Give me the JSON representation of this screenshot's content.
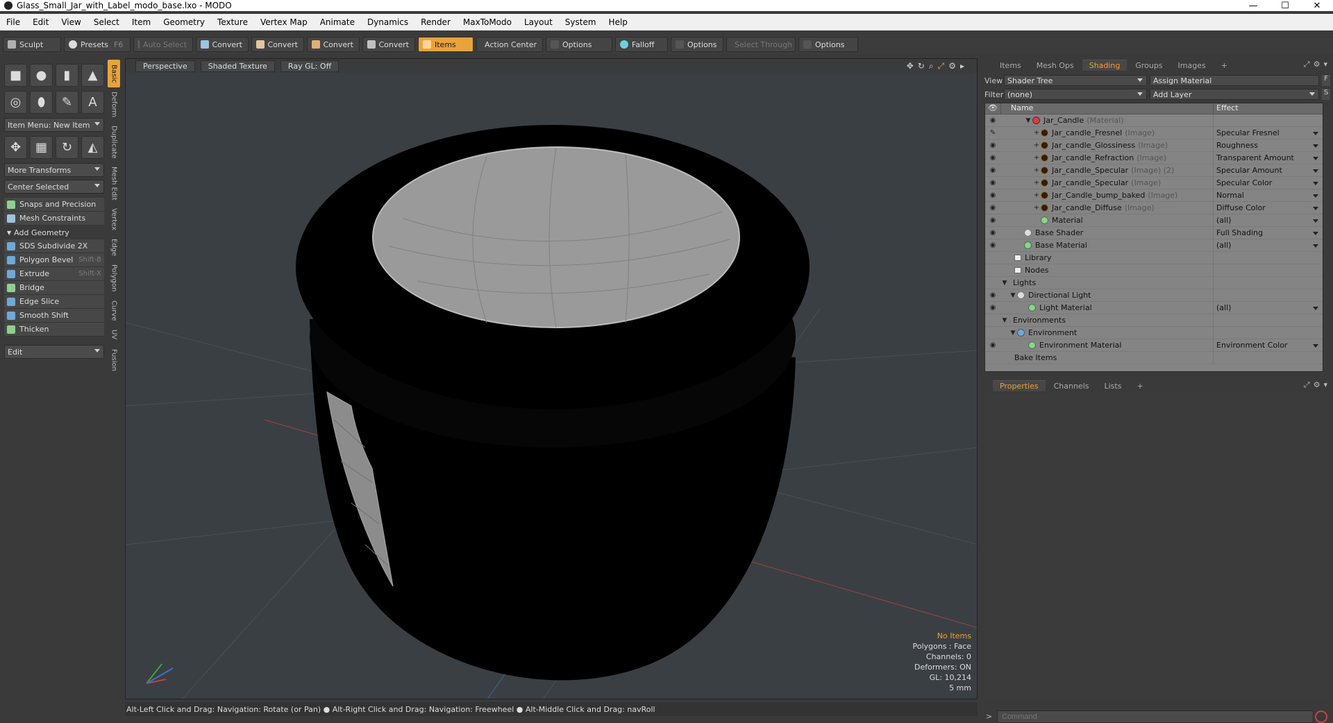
{
  "window": {
    "title": "Glass_Small_Jar_with_Label_modo_base.lxo - MODO",
    "minimize": "—",
    "maximize": "☐",
    "close": "✕"
  },
  "menubar": [
    "File",
    "Edit",
    "View",
    "Select",
    "Item",
    "Geometry",
    "Texture",
    "Vertex Map",
    "Animate",
    "Dynamics",
    "Render",
    "MaxToModo",
    "Layout",
    "System",
    "Help"
  ],
  "toolbar": {
    "sculpt": "Sculpt",
    "presets": "Presets",
    "presets_shortcut": "F6",
    "auto_select": "Auto Select",
    "convert1": "Convert",
    "convert2": "Convert",
    "convert3": "Convert",
    "convert4": "Convert",
    "items": "Items",
    "action_center": "Action Center",
    "options1": "Options",
    "falloff": "Falloff",
    "options2": "Options",
    "select_through": "Select Through",
    "options3": "Options"
  },
  "toolbox": {
    "item_menu": "Item Menu: New Item",
    "more_transforms": "More Transforms",
    "center_selected": "Center Selected",
    "snaps": "Snaps and Precision",
    "mesh_constraints": "Mesh Constraints",
    "add_geometry": "Add Geometry",
    "tools": [
      {
        "label": "SDS Subdivide 2X",
        "shortcut": ""
      },
      {
        "label": "Polygon Bevel",
        "shortcut": "Shift-B"
      },
      {
        "label": "Extrude",
        "shortcut": "Shift-X"
      },
      {
        "label": "Bridge",
        "shortcut": ""
      },
      {
        "label": "Edge Slice",
        "shortcut": ""
      },
      {
        "label": "Smooth Shift",
        "shortcut": ""
      },
      {
        "label": "Thicken",
        "shortcut": ""
      }
    ],
    "edit": "Edit"
  },
  "vtabs": [
    "Basic",
    "Deform",
    "Duplicate",
    "Mesh Edit",
    "Vertex",
    "Edge",
    "Polygon",
    "Curve",
    "UV",
    "Fusion"
  ],
  "viewport": {
    "perspective": "Perspective",
    "shaded_texture": "Shaded Texture",
    "ray_gl": "Ray GL: Off",
    "info": {
      "no_items": "No Items",
      "polygons": "Polygons : Face",
      "channels": "Channels: 0",
      "deformers": "Deformers: ON",
      "gl": "GL: 10,214",
      "scale": "5 mm"
    }
  },
  "statusbar": "Alt-Left Click and Drag: Navigation: Rotate (or Pan) ● Alt-Right Click and Drag: Navigation: Freewheel ● Alt-Middle Click and Drag: navRoll",
  "rightpanel": {
    "tabs": [
      "Items",
      "Mesh Ops",
      "Shading",
      "Groups",
      "Images"
    ],
    "view_label": "View",
    "view_value": "Shader Tree",
    "assign_material": "Assign Material",
    "filter_label": "Filter",
    "filter_value": "(none)",
    "add_layer": "Add Layer",
    "col_name": "Name",
    "col_effect": "Effect",
    "rows": [
      {
        "name": "Jar_Candle",
        "tag": "(Material)",
        "effect": ""
      },
      {
        "name": "Jar_candle_Fresnel",
        "tag": "(Image)",
        "effect": "Specular Fresnel"
      },
      {
        "name": "Jar_candle_Glossiness",
        "tag": "(Image)",
        "effect": "Roughness"
      },
      {
        "name": "Jar_candle_Refraction",
        "tag": "(Image)",
        "effect": "Transparent Amount"
      },
      {
        "name": "Jar_candle_Specular",
        "tag": "(Image) (2)",
        "effect": "Specular Amount"
      },
      {
        "name": "Jar_candle_Specular",
        "tag": "(Image)",
        "effect": "Specular Color"
      },
      {
        "name": "Jar_Candle_bump_baked",
        "tag": "(Image)",
        "effect": "Normal"
      },
      {
        "name": "Jar_candle_Diffuse",
        "tag": "(Image)",
        "effect": "Diffuse Color"
      },
      {
        "name": "Material",
        "tag": "",
        "effect": "(all)"
      },
      {
        "name": "Base Shader",
        "tag": "",
        "effect": "Full Shading"
      },
      {
        "name": "Base Material",
        "tag": "",
        "effect": "(all)"
      },
      {
        "name": "Library",
        "tag": "",
        "effect": ""
      },
      {
        "name": "Nodes",
        "tag": "",
        "effect": ""
      },
      {
        "name": "Lights",
        "tag": "",
        "effect": ""
      },
      {
        "name": "Directional Light",
        "tag": "",
        "effect": ""
      },
      {
        "name": "Light Material",
        "tag": "",
        "effect": "(all)"
      },
      {
        "name": "Environments",
        "tag": "",
        "effect": ""
      },
      {
        "name": "Environment",
        "tag": "",
        "effect": ""
      },
      {
        "name": "Environment Material",
        "tag": "",
        "effect": "Environment Color"
      },
      {
        "name": "Bake Items",
        "tag": "",
        "effect": ""
      }
    ],
    "prop_tabs": [
      "Properties",
      "Channels",
      "Lists"
    ],
    "command_placeholder": "Command"
  },
  "colors": {
    "accent": "#e8a33b",
    "panel": "#3a3a3a",
    "tree_bg": "#848484"
  }
}
